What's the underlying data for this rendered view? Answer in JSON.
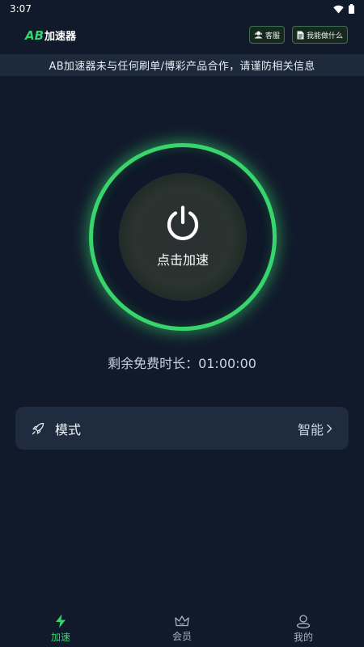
{
  "status_bar": {
    "time": "3:07"
  },
  "header": {
    "logo_ab": "AB",
    "logo_text": "加速器",
    "buttons": [
      {
        "label": "客服",
        "icon": "customer-service-icon"
      },
      {
        "label": "我能做什么",
        "icon": "document-icon"
      }
    ]
  },
  "notice": "AB加速器未与任何刷单/博彩产品合作，请谨防相关信息",
  "power": {
    "label": "点击加速",
    "icon": "power-icon"
  },
  "remaining": "剩余免费时长：01:00:00",
  "mode": {
    "label": "模式",
    "value": "智能",
    "icon": "rocket-icon"
  },
  "tabs": [
    {
      "label": "加速",
      "icon": "lightning-icon",
      "active": true
    },
    {
      "label": "会员",
      "icon": "crown-icon",
      "active": false
    },
    {
      "label": "我的",
      "icon": "profile-icon",
      "active": false
    }
  ],
  "colors": {
    "accent": "#35d46e",
    "background": "#111a2b",
    "card": "#1f2c40"
  }
}
